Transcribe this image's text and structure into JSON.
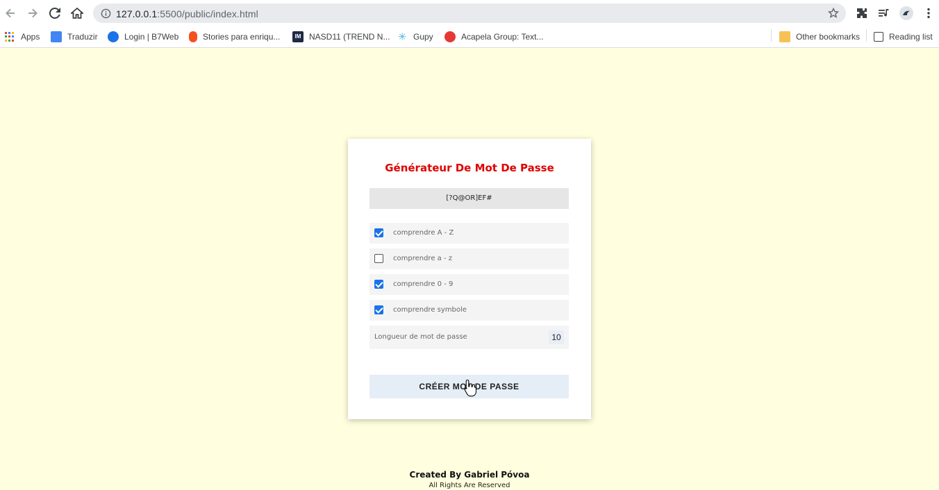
{
  "browser": {
    "url_host": "127.0.0.1",
    "url_rest": ":5500/public/index.html",
    "bookmarks": [
      {
        "label": "Apps",
        "icon": "apps-grid-icon",
        "color": "#ea4335"
      },
      {
        "label": "Traduzir",
        "icon": "google-translate-icon",
        "color": "#4285f4"
      },
      {
        "label": "Login | B7Web",
        "icon": "b7web-icon",
        "color": "#1a73e8"
      },
      {
        "label": "Stories para enriqu...",
        "icon": "fire-icon",
        "color": "#f4511e"
      },
      {
        "label": "NASD11 (TREND N...",
        "icon": "im-icon",
        "color": "#1f2a44"
      },
      {
        "label": "Gupy",
        "icon": "gupy-icon",
        "color": "#4db6e0"
      },
      {
        "label": "Acapela Group: Text...",
        "icon": "acapela-icon",
        "color": "#e53935"
      }
    ],
    "other_bookmarks": "Other bookmarks",
    "reading_list": "Reading list"
  },
  "generator": {
    "title": "Générateur De Mot De Passe",
    "result": "[?Q@OR]EF#",
    "options": [
      {
        "label": "comprendre A - Z",
        "checked": true
      },
      {
        "label": "comprendre a - z",
        "checked": false
      },
      {
        "label": "comprendre 0 - 9",
        "checked": true
      },
      {
        "label": "comprendre symbole",
        "checked": true
      }
    ],
    "length_label": "Longueur de mot de passe",
    "length_value": "10",
    "button_label": "CRÉER MOT DE PASSE"
  },
  "footer": {
    "credit": "Created By Gabriel Póvoa",
    "rights": "All Rights Are Reserved"
  },
  "colors": {
    "page_bg": "#ffffdf",
    "title": "#e00000",
    "checkbox_on": "#1a73e8",
    "button_bg": "#e5eef7"
  }
}
